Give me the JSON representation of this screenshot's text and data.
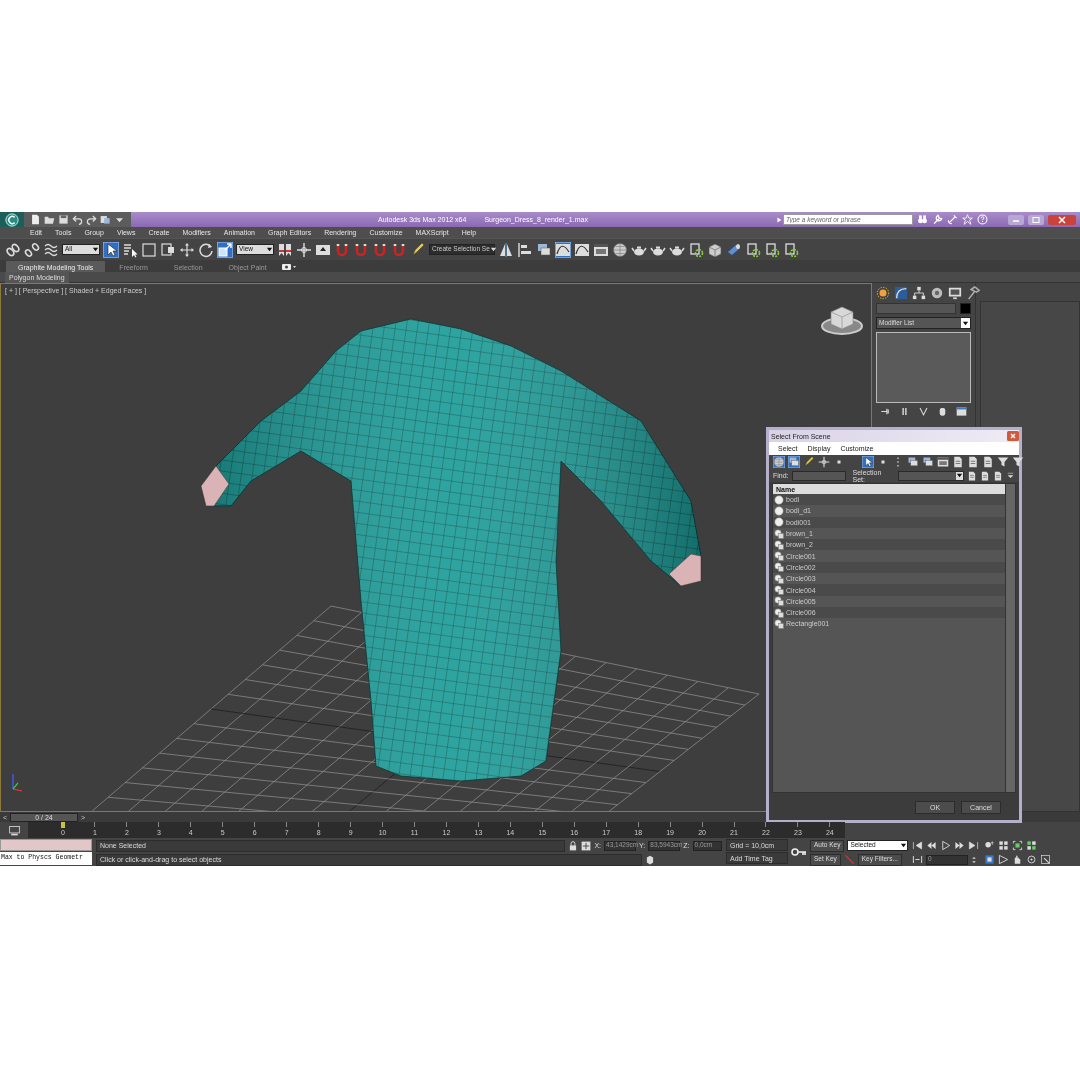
{
  "title_bar": {
    "app": "Autodesk 3ds Max  2012 x64",
    "file": "Surgeon_Dress_8_render_1.max",
    "search": {
      "placeholder": "Type a keyword or phrase"
    }
  },
  "menu": [
    "Edit",
    "Tools",
    "Group",
    "Views",
    "Create",
    "Modifiers",
    "Animation",
    "Graph Editors",
    "Rendering",
    "Customize",
    "MAXScript",
    "Help"
  ],
  "main_toolbar": {
    "items": [
      {
        "kind": "link",
        "selected": false
      },
      {
        "kind": "unlink",
        "selected": false
      },
      {
        "kind": "bind",
        "selected": false
      },
      {
        "kind": "dropdown",
        "value": "All"
      },
      {
        "kind": "cursor",
        "selected": true
      },
      {
        "kind": "list",
        "selected": false
      },
      {
        "kind": "rect",
        "selected": false
      },
      {
        "kind": "window",
        "selected": false
      },
      {
        "kind": "move",
        "selected": false
      },
      {
        "kind": "rotate",
        "selected": false
      },
      {
        "kind": "scale",
        "selected": true
      },
      {
        "kind": "dropdown",
        "value": "View"
      },
      {
        "kind": "bookmark",
        "selected": false
      },
      {
        "kind": "pivot",
        "selected": false
      },
      {
        "kind": "panel",
        "selected": false
      },
      {
        "kind": "magnet",
        "selected": false
      },
      {
        "kind": "magnet",
        "selected": false
      },
      {
        "kind": "magnet",
        "selected": false
      },
      {
        "kind": "magnet",
        "selected": false
      },
      {
        "kind": "pen",
        "selected": false
      },
      {
        "kind": "dropdown",
        "value": "Create Selection Se"
      },
      {
        "kind": "mirror",
        "selected": false
      },
      {
        "kind": "align",
        "selected": false
      },
      {
        "kind": "layers",
        "selected": false
      },
      {
        "kind": "curve",
        "selected": true
      },
      {
        "kind": "curve",
        "selected": false
      },
      {
        "kind": "frame",
        "selected": false
      },
      {
        "kind": "sphere",
        "selected": false
      },
      {
        "kind": "teapot",
        "selected": false
      },
      {
        "kind": "teapot",
        "selected": false
      },
      {
        "kind": "teapot",
        "selected": false
      },
      {
        "kind": "film",
        "selected": false
      },
      {
        "kind": "cube",
        "selected": false
      },
      {
        "kind": "tube",
        "selected": false
      },
      {
        "kind": "film",
        "selected": false
      },
      {
        "kind": "film",
        "selected": false
      },
      {
        "kind": "film",
        "selected": false
      }
    ]
  },
  "ribbon": {
    "tabs": [
      {
        "label": "Graphite Modeling Tools",
        "selected": true
      },
      {
        "label": "Freeform",
        "selected": false
      },
      {
        "label": "Selection",
        "selected": false
      },
      {
        "label": "Object Paint",
        "selected": false
      }
    ],
    "panel": "Polygon Modeling"
  },
  "viewport": {
    "label": "[ + ] [ Perspective ] [ Shaded + Edged Faces ]"
  },
  "command_panel": {
    "modifier_list": "Modifier List"
  },
  "dialog": {
    "title": "Select From Scene",
    "menu": [
      "Select",
      "Display",
      "Customize"
    ],
    "toolbar": [
      {
        "kind": "sphere",
        "selected": true
      },
      {
        "kind": "layers",
        "selected": true
      },
      {
        "kind": "pen",
        "selected": false
      },
      {
        "kind": "pivot",
        "selected": false
      },
      {
        "kind": "dot",
        "selected": false
      },
      {
        "kind": "cursor",
        "selected": true
      },
      {
        "kind": "dot",
        "selected": false
      },
      {
        "kind": "dots",
        "selected": false
      },
      {
        "kind": "layers",
        "selected": false
      },
      {
        "kind": "layers",
        "selected": false
      },
      {
        "kind": "frame",
        "selected": false
      },
      {
        "kind": "doc",
        "selected": false
      },
      {
        "kind": "doc",
        "selected": false
      },
      {
        "kind": "doc",
        "selected": false
      },
      {
        "kind": "filter",
        "selected": false
      },
      {
        "kind": "filter",
        "selected": false
      }
    ],
    "find_label": "Find:",
    "selection_set_label": "Selection Set:",
    "column": "Name",
    "rows": [
      {
        "name": "bodi",
        "kind": "geometry",
        "selected": false
      },
      {
        "name": "bodi_d1",
        "kind": "geometry",
        "selected": false
      },
      {
        "name": "bodi001",
        "kind": "geometry",
        "selected": false
      },
      {
        "name": "brown_1",
        "kind": "shape",
        "selected": false
      },
      {
        "name": "brown_2",
        "kind": "shape",
        "selected": false
      },
      {
        "name": "Circle001",
        "kind": "shape",
        "selected": false
      },
      {
        "name": "Circle002",
        "kind": "shape",
        "selected": false
      },
      {
        "name": "Circle003",
        "kind": "shape",
        "selected": false
      },
      {
        "name": "Circle004",
        "kind": "shape",
        "selected": false
      },
      {
        "name": "Circle005",
        "kind": "shape",
        "selected": false
      },
      {
        "name": "Circle006",
        "kind": "shape",
        "selected": false
      },
      {
        "name": "Rectangle001",
        "kind": "shape",
        "selected": false
      }
    ],
    "buttons": [
      "OK",
      "Cancel"
    ]
  },
  "time_slider": {
    "prev": "<",
    "frame": "0 / 24",
    "next": ">"
  },
  "track_bar": {
    "ticks": [
      "0",
      "1",
      "2",
      "3",
      "4",
      "5",
      "6",
      "7",
      "8",
      "9",
      "10",
      "11",
      "12",
      "13",
      "14",
      "15",
      "16",
      "17",
      "18",
      "19",
      "20",
      "21",
      "22",
      "23",
      "24"
    ]
  },
  "status": {
    "listener": "Max to Physcs Geometr",
    "selection": "None Selected",
    "prompt": "Click or click-and-drag to select objects",
    "x_label": "X:",
    "x": "43,1429cm",
    "y_label": "Y:",
    "y": "83,5943cm",
    "z_label": "Z:",
    "z": "0,0cm",
    "grid": "Grid = 10,0cm",
    "time_tag": "Add Time Tag",
    "auto_key": "Auto Key",
    "key_mode": "Selected",
    "set_key": "Set Key",
    "key_filters": "Key Filters...",
    "frame": "0"
  }
}
